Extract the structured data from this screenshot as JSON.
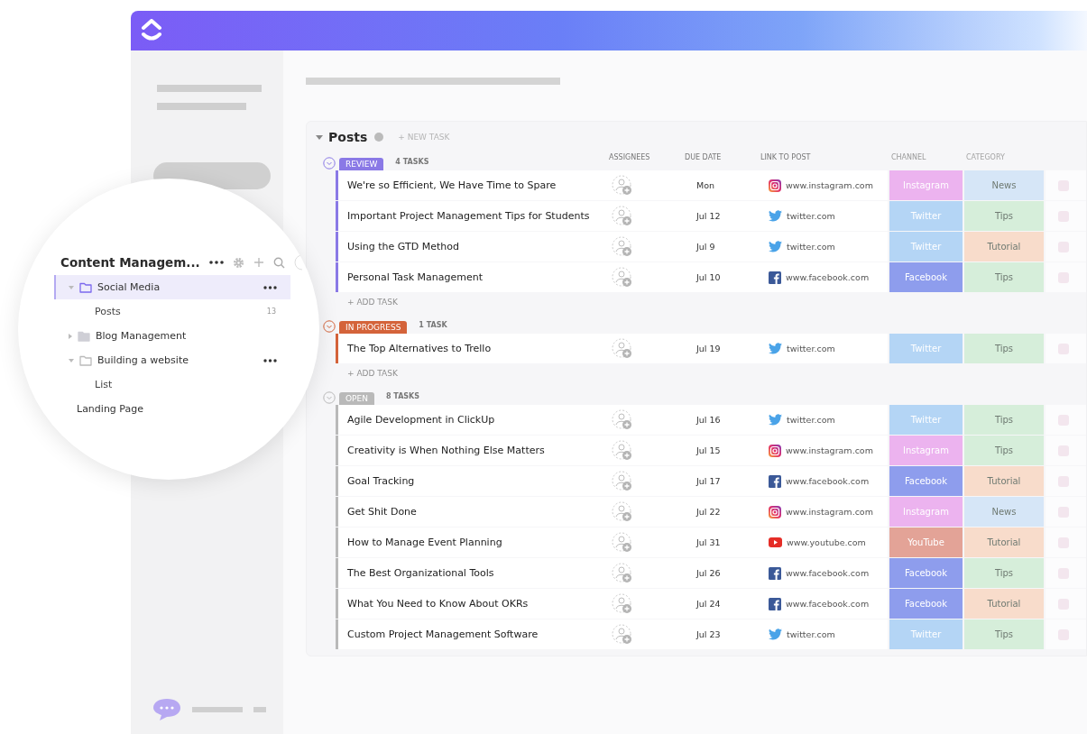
{
  "list": {
    "title": "Posts",
    "new_task": "+ NEW TASK",
    "columns": [
      "ASSIGNEES",
      "DUE DATE",
      "LINK TO POST",
      "CHANNEL",
      "CATEGORY"
    ]
  },
  "groups": [
    {
      "status": "REVIEW",
      "color": "#8a79e6",
      "count": "4 TASKS",
      "expanded": true,
      "add_task": "+ ADD TASK",
      "tasks": [
        {
          "title": "We're so Efficient, We Have Time to Spare",
          "due": "Mon",
          "link": {
            "kind": "instagram",
            "text": "www.instagram.com"
          },
          "channel": {
            "label": "Instagram",
            "color": "#ecb3ef"
          },
          "category": {
            "label": "News",
            "color": "#d6e6f7"
          }
        },
        {
          "title": "Important Project Management Tips for Students",
          "due": "Jul 12",
          "link": {
            "kind": "twitter",
            "text": "twitter.com"
          },
          "channel": {
            "label": "Twitter",
            "color": "#b4d5f5"
          },
          "category": {
            "label": "Tips",
            "color": "#d6eeda"
          }
        },
        {
          "title": "Using the GTD Method",
          "due": "Jul 9",
          "link": {
            "kind": "twitter",
            "text": "twitter.com"
          },
          "channel": {
            "label": "Twitter",
            "color": "#b4d5f5"
          },
          "category": {
            "label": "Tutorial",
            "color": "#f8dccb"
          }
        },
        {
          "title": "Personal Task Management",
          "due": "Jul 10",
          "link": {
            "kind": "facebook",
            "text": "www.facebook.com"
          },
          "channel": {
            "label": "Facebook",
            "color": "#8e9ded"
          },
          "category": {
            "label": "Tips",
            "color": "#d6eeda"
          }
        }
      ]
    },
    {
      "status": "IN PROGRESS",
      "color": "#d4633a",
      "count": "1 TASK",
      "expanded": true,
      "add_task": "+ ADD TASK",
      "tasks": [
        {
          "title": "The Top Alternatives to Trello",
          "due": "Jul 19",
          "link": {
            "kind": "twitter",
            "text": "twitter.com"
          },
          "channel": {
            "label": "Twitter",
            "color": "#b4d5f5"
          },
          "category": {
            "label": "Tips",
            "color": "#d6eeda"
          }
        }
      ]
    },
    {
      "status": "OPEN",
      "color": "#b9b9b9",
      "count": "8 TASKS",
      "expanded": true,
      "tasks": [
        {
          "title": "Agile Development in ClickUp",
          "due": "Jul 16",
          "link": {
            "kind": "twitter",
            "text": "twitter.com"
          },
          "channel": {
            "label": "Twitter",
            "color": "#b4d5f5"
          },
          "category": {
            "label": "Tips",
            "color": "#d6eeda"
          }
        },
        {
          "title": "Creativity is When Nothing Else Matters",
          "due": "Jul 15",
          "link": {
            "kind": "instagram",
            "text": "www.instagram.com"
          },
          "channel": {
            "label": "Instagram",
            "color": "#ecb3ef"
          },
          "category": {
            "label": "Tips",
            "color": "#d6eeda"
          }
        },
        {
          "title": "Goal Tracking",
          "due": "Jul 17",
          "link": {
            "kind": "facebook",
            "text": "www.facebook.com"
          },
          "channel": {
            "label": "Facebook",
            "color": "#8e9ded"
          },
          "category": {
            "label": "Tutorial",
            "color": "#f8dccb"
          }
        },
        {
          "title": "Get Shit Done",
          "due": "Jul 22",
          "link": {
            "kind": "instagram",
            "text": "www.instagram.com"
          },
          "channel": {
            "label": "Instagram",
            "color": "#ecb3ef"
          },
          "category": {
            "label": "News",
            "color": "#d6e6f7"
          }
        },
        {
          "title": "How to Manage Event Planning",
          "due": "Jul 31",
          "link": {
            "kind": "youtube",
            "text": "www.youtube.com"
          },
          "channel": {
            "label": "YouTube",
            "color": "#e3a397"
          },
          "category": {
            "label": "Tutorial",
            "color": "#f8dccb"
          }
        },
        {
          "title": "The Best Organizational Tools",
          "due": "Jul 26",
          "link": {
            "kind": "facebook",
            "text": "www.facebook.com"
          },
          "channel": {
            "label": "Facebook",
            "color": "#8e9ded"
          },
          "category": {
            "label": "Tips",
            "color": "#d6eeda"
          }
        },
        {
          "title": "What You Need to Know About OKRs",
          "due": "Jul 24",
          "link": {
            "kind": "facebook",
            "text": "www.facebook.com"
          },
          "channel": {
            "label": "Facebook",
            "color": "#8e9ded"
          },
          "category": {
            "label": "Tutorial",
            "color": "#f8dccb"
          }
        },
        {
          "title": "Custom Project Management Software",
          "due": "Jul 23",
          "link": {
            "kind": "twitter",
            "text": "twitter.com"
          },
          "channel": {
            "label": "Twitter",
            "color": "#b4d5f5"
          },
          "category": {
            "label": "Tips",
            "color": "#d6eeda"
          }
        }
      ]
    }
  ],
  "sidebar": {
    "title": "Content Managem...",
    "items": [
      {
        "label": "Social Media",
        "kind": "folder",
        "selected": true,
        "expanded": true,
        "children": [
          {
            "label": "Posts",
            "kind": "list",
            "selected": false,
            "count": "13"
          }
        ]
      },
      {
        "label": "Blog Management",
        "kind": "folder",
        "selected": false,
        "expanded": false
      },
      {
        "label": "Building a website",
        "kind": "folder",
        "selected": false,
        "expanded": true,
        "children": [
          {
            "label": "List",
            "kind": "list",
            "selected": false
          }
        ]
      },
      {
        "label": "Landing Page",
        "kind": "page",
        "selected": false
      }
    ]
  }
}
